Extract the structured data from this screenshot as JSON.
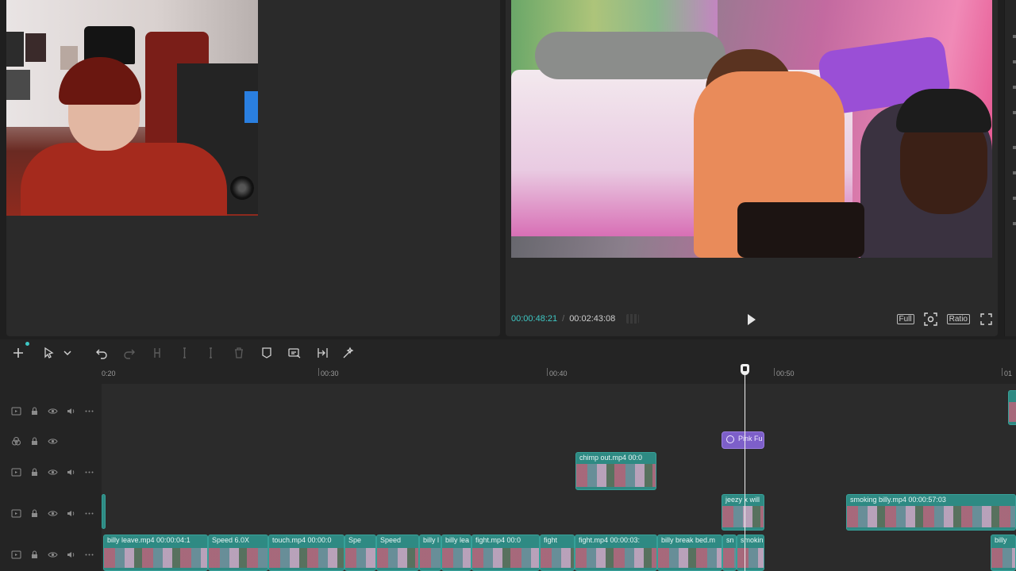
{
  "preview": {
    "current_time": "00:00:48:21",
    "separator": "/",
    "total_time": "00:02:43:08",
    "full_label": "Full",
    "ratio_label": "Ratio"
  },
  "ruler": {
    "labels": [
      "0:20",
      "00:30",
      "00:40",
      "00:50",
      "01"
    ]
  },
  "clips": {
    "chimp_out": "chimp out.mp4   00:0",
    "pink_fx": "Pink Fu",
    "jeezy": "jeezy x will",
    "smoking_billy": "smoking billy.mp4   00:00:57:03",
    "billy_leave": "billy leave.mp4   00:00:04:1",
    "speed_6": "Speed 6.0X",
    "touch": "touch.mp4   00:00:0",
    "spe": "Spe",
    "speed_b": "Speed",
    "billy_a": "billy l",
    "billy_le": "billy lea",
    "fight1": "fight.mp4   00:0",
    "fight2": "fight",
    "fight3": "fight.mp4   00:00:03:",
    "billy_break": "billy break bed.m",
    "sn": "sn",
    "smokin": "smokin",
    "billy_end": "billy"
  },
  "colors": {
    "accent": "#3ec7c4",
    "clip": "#2e8a83",
    "fx": "#7d5fc9",
    "background": "#1f1f1f"
  }
}
